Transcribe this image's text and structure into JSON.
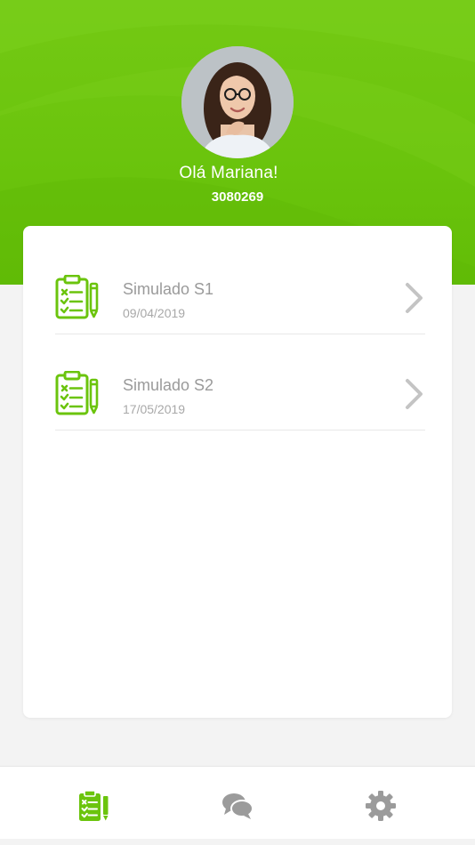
{
  "header": {
    "greeting": "Olá Mariana!",
    "user_id": "3080269"
  },
  "exams": [
    {
      "title": "Simulado S1",
      "date": "09/04/2019"
    },
    {
      "title": "Simulado S2",
      "date": "17/05/2019"
    }
  ],
  "tabbar": {
    "tabs": [
      {
        "icon": "clipboard-icon",
        "active": true
      },
      {
        "icon": "chat-icon",
        "active": false
      },
      {
        "icon": "gear-icon",
        "active": false
      }
    ]
  },
  "colors": {
    "brand_green": "#6bc40d",
    "text_gray": "#9a9a9a",
    "inactive_icon": "#9b9b9b"
  }
}
